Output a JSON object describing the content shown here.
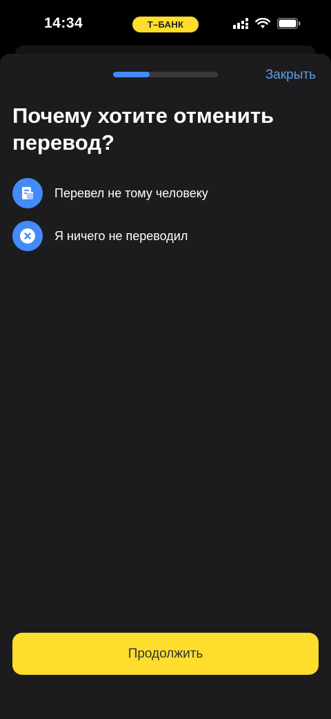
{
  "status_bar": {
    "time": "14:34",
    "bank_badge": "Т–БАНК",
    "icons": [
      "cellular-signal-icon",
      "wifi-icon",
      "battery-icon"
    ]
  },
  "sheet": {
    "progress_fraction": 0.35,
    "close_label": "Закрыть",
    "title": "Почему хотите отменить перевод?",
    "options": [
      {
        "icon": "document-icon",
        "label": "Перевел не тому человеку"
      },
      {
        "icon": "cancel-x-icon",
        "label": "Я ничего не переводил"
      }
    ],
    "continue_label": "Продолжить"
  },
  "colors": {
    "accent_blue": "#428BF9",
    "link_blue": "#5D9CEC",
    "brand_yellow": "#FFDD2D",
    "sheet_bg": "#1c1c1e"
  }
}
